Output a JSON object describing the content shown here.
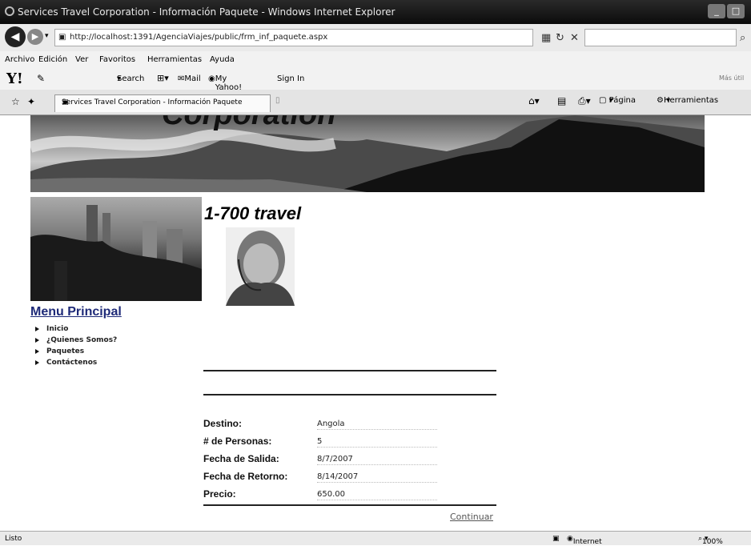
{
  "window": {
    "title": "Services Travel Corporation - Información Paquete - Windows Internet Explorer",
    "controls": [
      "minimize-icon",
      "maximize-icon"
    ]
  },
  "browser": {
    "url": "http://localhost:1391/AgenciaViajes/public/frm_inf_paquete.aspx",
    "menu": [
      "Archivo",
      "Edición",
      "Ver",
      "Favoritos",
      "Herramientas",
      "Ayuda"
    ],
    "yahoo": {
      "search": "Search",
      "mail": "Mail",
      "myyahoo": "My Yahoo!",
      "signin": "Sign In",
      "more": "Más útil"
    },
    "tab_title": "Services Travel Corporation - Información Paquete",
    "page_menu": "Página",
    "tools_menu": "Herramientas"
  },
  "page": {
    "banner_title": "Corporation",
    "brand": "1-700 travel",
    "menu_title": "Menu Principal",
    "menu_items": [
      "Inicio",
      "¿Quienes Somos?",
      "Paquetes",
      "Contáctenos"
    ],
    "details": [
      {
        "label": "Destino:",
        "value": "Angola"
      },
      {
        "label": "# de Personas:",
        "value": "5"
      },
      {
        "label": "Fecha de Salida:",
        "value": "8/7/2007"
      },
      {
        "label": "Fecha de Retorno:",
        "value": "8/14/2007"
      },
      {
        "label": "Precio:",
        "value": "650.00"
      }
    ],
    "continue_link": "Continuar"
  },
  "status": {
    "left": "Listo",
    "zone": "Internet",
    "zoom": "100%"
  }
}
